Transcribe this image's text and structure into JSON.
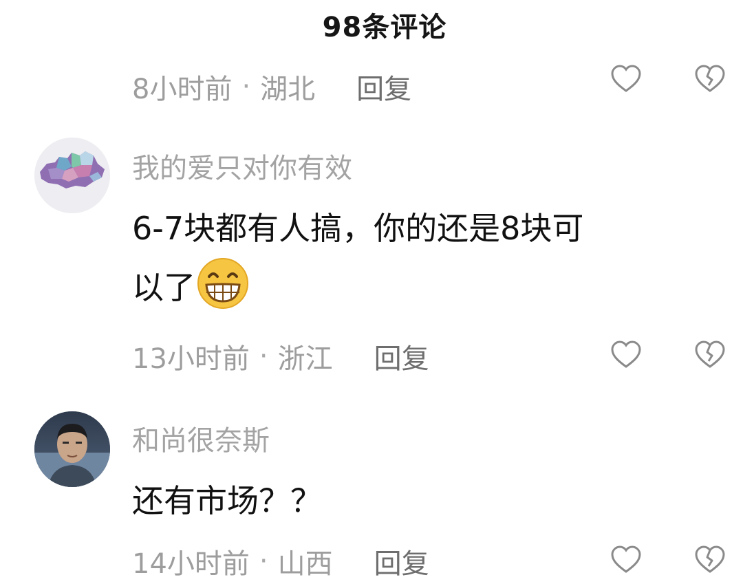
{
  "header": {
    "title": "98条评论"
  },
  "comments": [
    {
      "time": "8小时前",
      "location": "湖北",
      "reply_label": "回复"
    },
    {
      "username": "我的爱只对你有效",
      "text_line1": "6-7块都有人搞，你的还是8块可",
      "text_line2": "以了",
      "emoji": "grinning-face-emoji",
      "time": "13小时前",
      "location": "浙江",
      "reply_label": "回复"
    },
    {
      "username": "和尚很奈斯",
      "text_line1": "还有市场？？",
      "time": "14小时前",
      "location": "山西",
      "reply_label": "回复"
    }
  ],
  "icons": {
    "like": "heart-outline-icon",
    "dislike": "broken-heart-outline-icon"
  },
  "colors": {
    "text": "#111111",
    "meta": "#9d9d9d",
    "reply": "#6e6e6e"
  }
}
